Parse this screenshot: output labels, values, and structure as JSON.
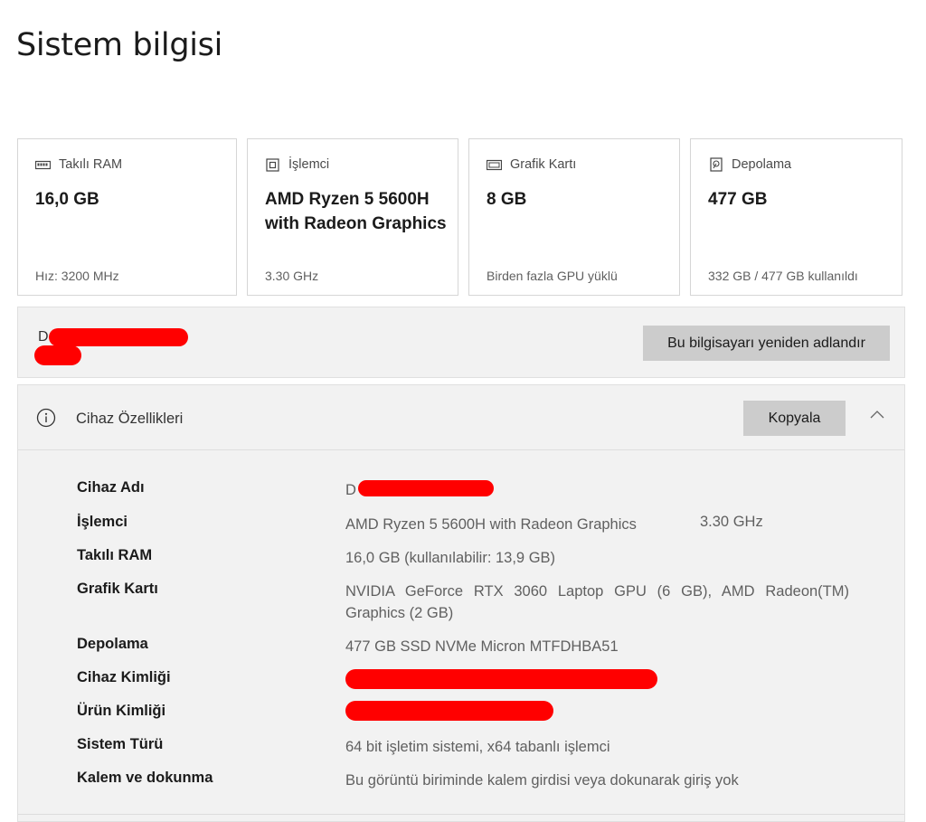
{
  "page": {
    "title": "Sistem bilgisi"
  },
  "cards": [
    {
      "label": "Takılı RAM",
      "icon": "ram-icon",
      "value": "16,0 GB",
      "sub": "Hız: 3200 MHz"
    },
    {
      "label": "İşlemci",
      "icon": "processor-icon",
      "value": "AMD Ryzen 5 5600H with Radeon Graphics",
      "sub": "3.30 GHz"
    },
    {
      "label": "Grafik Kartı",
      "icon": "graphics-card-icon",
      "value": "8 GB",
      "sub": "Birden fazla GPU yüklü"
    },
    {
      "label": "Depolama",
      "icon": "storage-icon",
      "value": "477 GB",
      "sub": "332 GB / 477 GB kullanıldı"
    }
  ],
  "rename": {
    "device_name_visible": "D",
    "button_label": "Bu bilgisayarı yeniden adlandır"
  },
  "device_specs": {
    "title": "Cihaz Özellikleri",
    "copy_label": "Kopyala",
    "rows": [
      {
        "label": "Cihaz Adı",
        "value": "D"
      },
      {
        "label": "İşlemci",
        "value": "AMD Ryzen 5 5600H with Radeon Graphics",
        "extra": "3.30 GHz"
      },
      {
        "label": "Takılı RAM",
        "value": "16,0 GB (kullanılabilir: 13,9 GB)"
      },
      {
        "label": "Grafik Kartı",
        "value": "NVIDIA GeForce RTX 3060 Laptop GPU (6 GB), AMD Radeon(TM) Graphics (2 GB)"
      },
      {
        "label": "Depolama",
        "value": "477 GB SSD NVMe Micron MTFDHBA51"
      },
      {
        "label": "Cihaz Kimliği",
        "value": ""
      },
      {
        "label": "Ürün Kimliği",
        "value": ""
      },
      {
        "label": "Sistem Türü",
        "value": "64 bit işletim sistemi, x64 tabanlı işlemci"
      },
      {
        "label": "Kalem ve dokunma",
        "value": "Bu görüntü biriminde kalem girdisi veya dokunarak giriş yok"
      }
    ]
  },
  "colors": {
    "redaction": "#ff0000",
    "button_bg": "#cccccc",
    "panel_bg": "#f2f2f2"
  }
}
